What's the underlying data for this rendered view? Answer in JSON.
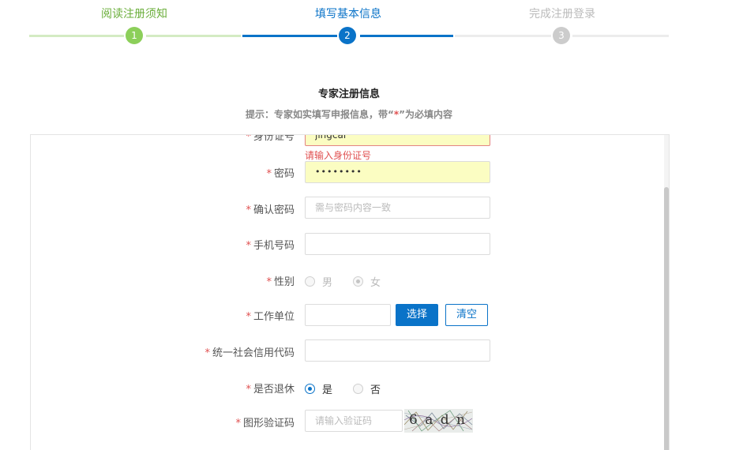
{
  "steps": [
    {
      "number": "1",
      "label": "阅读注册须知",
      "state": "done",
      "color": "#8ccf5a",
      "line_color": "#d4ebc3"
    },
    {
      "number": "2",
      "label": "填写基本信息",
      "state": "active",
      "color": "#0a73c8",
      "line_color": "#0a73c8"
    },
    {
      "number": "3",
      "label": "完成注册登录",
      "state": "pending",
      "color": "#cccccc",
      "line_color": "#ececec"
    }
  ],
  "header": {
    "title": "专家注册信息",
    "hint_prefix": "提示：专家如实填写申报信息，带",
    "hint_quote_open": "“",
    "hint_star": "*",
    "hint_quote_close": "”",
    "hint_suffix": "为必填内容"
  },
  "form": {
    "required_mark": "*",
    "id_number": {
      "label": "身份证号",
      "value": "jingcai",
      "error": "请输入身份证号"
    },
    "password": {
      "label": "密码",
      "value": "••••••••"
    },
    "confirm_password": {
      "label": "确认密码",
      "placeholder": "需与密码内容一致"
    },
    "phone": {
      "label": "手机号码",
      "value": ""
    },
    "gender": {
      "label": "性别",
      "options": [
        "男",
        "女"
      ],
      "selected": "女"
    },
    "work_unit": {
      "label": "工作单位",
      "value": "",
      "select_button": "选择",
      "clear_button": "清空"
    },
    "credit_code": {
      "label": "统一社会信用代码",
      "value": ""
    },
    "retired": {
      "label": "是否退休",
      "options": [
        "是",
        "否"
      ],
      "selected": "是"
    },
    "captcha": {
      "label": "图形验证码",
      "placeholder": "请输入验证码",
      "image_text": "6 a d n"
    }
  },
  "colors": {
    "primary": "#0a73c8",
    "required": "#e05050",
    "autofill": "#fbfdc2"
  }
}
